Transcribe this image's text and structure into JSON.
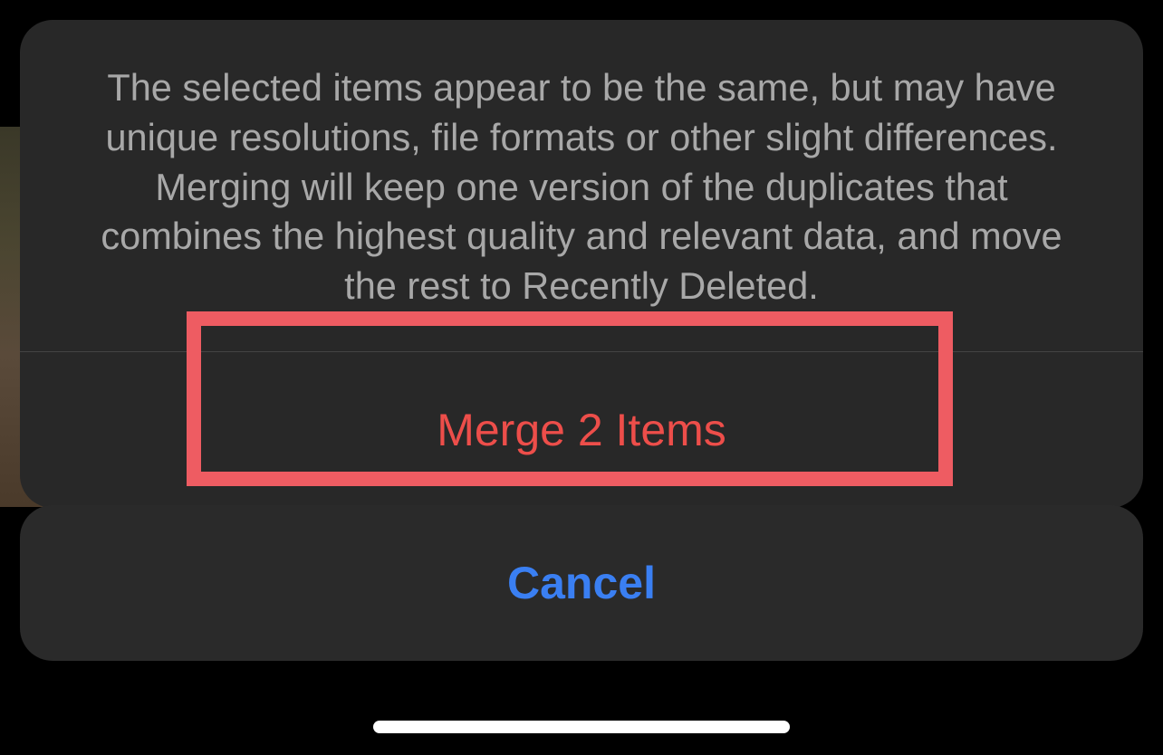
{
  "sheet": {
    "message": "The selected items appear to be the same, but may have unique resolutions, file formats or other slight differences. Merging will keep one version of the duplicates that combines the highest quality and relevant data, and move the rest to Recently Deleted.",
    "merge_label": "Merge 2 Items",
    "cancel_label": "Cancel"
  },
  "colors": {
    "destructive": "#ed4e4a",
    "accent": "#3a7ff2",
    "highlight": "#ee5c62"
  }
}
